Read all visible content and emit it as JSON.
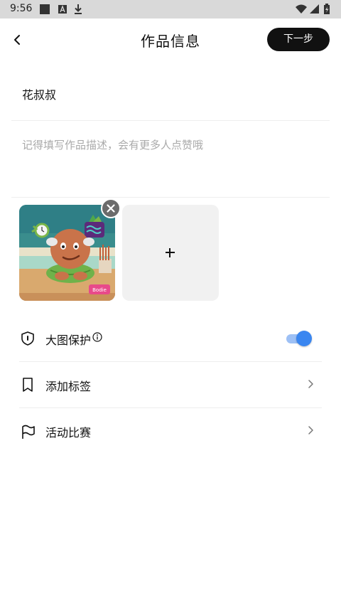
{
  "status_bar": {
    "time": "9:56",
    "left_icons": [
      "square-icon",
      "a-badge-icon",
      "download-icon"
    ],
    "right_icons": [
      "wifi-icon",
      "signal-icon",
      "battery-icon"
    ]
  },
  "header": {
    "title": "作品信息",
    "next_label": "下一步",
    "back_icon": "chevron-left-icon"
  },
  "form": {
    "title_value": "花叔叔",
    "description_placeholder": "记得填写作品描述，会有更多人点赞哦"
  },
  "media": {
    "items": [
      {
        "type": "image",
        "label": "Bodie"
      }
    ],
    "add_icon": "plus-icon",
    "remove_icon": "close-icon"
  },
  "settings": {
    "protection": {
      "label": "大图保护",
      "enabled": true,
      "icon": "shield-icon"
    },
    "tags": {
      "label": "添加标签",
      "icon": "bookmark-icon"
    },
    "events": {
      "label": "活动比赛",
      "icon": "flag-icon"
    }
  },
  "colors": {
    "accent": "#3a86f0",
    "primary_button": "#111111",
    "placeholder": "#aaaaaa"
  }
}
